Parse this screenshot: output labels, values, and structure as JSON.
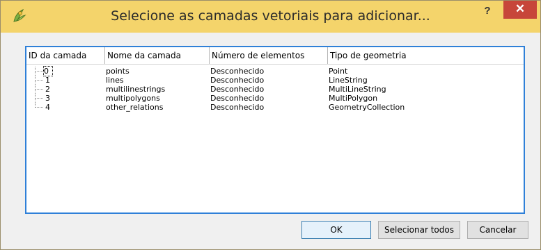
{
  "window": {
    "title": "Selecione as camadas vetoriais para adicionar...",
    "help_label": "?",
    "close_label": "✕"
  },
  "table": {
    "headers": [
      "ID da camada",
      "Nome da camada",
      "Número de elementos",
      "Tipo de geometria"
    ],
    "rows": [
      {
        "id": "0",
        "name": "points",
        "count": "Desconhecido",
        "geom": "Point"
      },
      {
        "id": "1",
        "name": "lines",
        "count": "Desconhecido",
        "geom": "LineString"
      },
      {
        "id": "2",
        "name": "multilinestrings",
        "count": "Desconhecido",
        "geom": "MultiLineString"
      },
      {
        "id": "3",
        "name": "multipolygons",
        "count": "Desconhecido",
        "geom": "MultiPolygon"
      },
      {
        "id": "4",
        "name": "other_relations",
        "count": "Desconhecido",
        "geom": "GeometryCollection"
      }
    ]
  },
  "buttons": {
    "ok": "OK",
    "select_all": "Selecionar todos",
    "cancel": "Cancelar"
  }
}
